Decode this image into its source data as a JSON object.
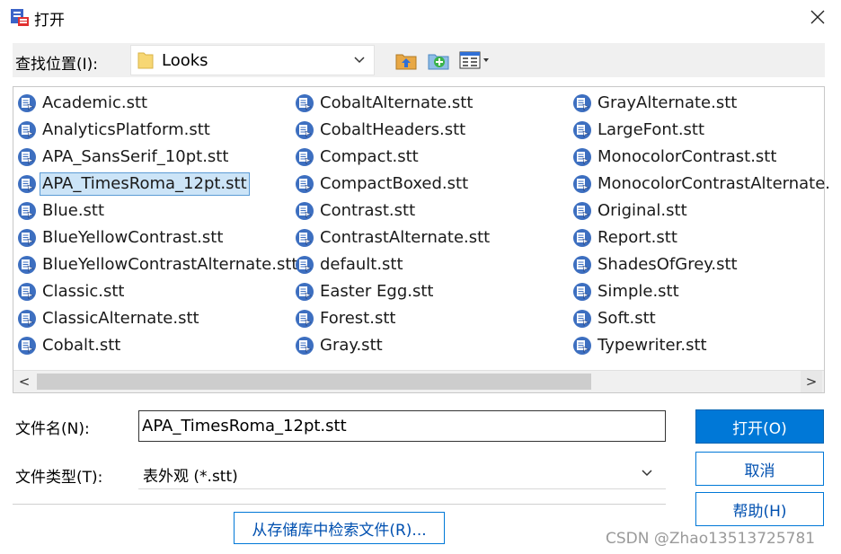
{
  "window": {
    "title": "打开",
    "close_symbol": "✕"
  },
  "lookin": {
    "label": "查找位置(I):",
    "value": "Looks"
  },
  "toolbar": {
    "up_icon": "up-folder-icon",
    "new_icon": "new-folder-icon",
    "view_icon": "view-menu-icon"
  },
  "files": [
    "Academic.stt",
    "AnalyticsPlatform.stt",
    "APA_SansSerif_10pt.stt",
    "APA_TimesRoma_12pt.stt",
    "Blue.stt",
    "BlueYellowContrast.stt",
    "BlueYellowContrastAlternate.stt",
    "Classic.stt",
    "ClassicAlternate.stt",
    "Cobalt.stt",
    "CobaltAlternate.stt",
    "CobaltHeaders.stt",
    "Compact.stt",
    "CompactBoxed.stt",
    "Contrast.stt",
    "ContrastAlternate.stt",
    "default.stt",
    "Easter Egg.stt",
    "Forest.stt",
    "Gray.stt",
    "GrayAlternate.stt",
    "LargeFont.stt",
    "MonocolorContrast.stt",
    "MonocolorContrastAlternate.",
    "Original.stt",
    "Report.stt",
    "ShadesOfGrey.stt",
    "Simple.stt",
    "Soft.stt",
    "Typewriter.stt"
  ],
  "selected_file": "APA_TimesRoma_12pt.stt",
  "scroll": {
    "left": "<",
    "right": ">"
  },
  "filename": {
    "label": "文件名(N):",
    "value": "APA_TimesRoma_12pt.stt"
  },
  "filetype": {
    "label": "文件类型(T):",
    "value": "表外观 (*.stt)"
  },
  "buttons": {
    "open": "打开(O)",
    "cancel": "取消",
    "help": "帮助(H)",
    "repository": "从存储库中检索文件(R)..."
  },
  "watermark": "CSDN @Zhao13513725781",
  "colors": {
    "accent": "#0078d7",
    "selection": "#cce4f7",
    "toolbar_bg": "#f0f0f0"
  }
}
